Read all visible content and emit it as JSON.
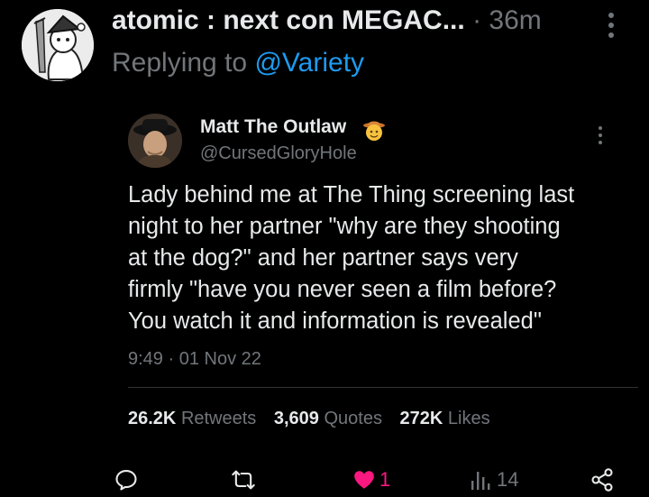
{
  "reply": {
    "display_name": "atomic : next con MEGAC...",
    "separator": "·",
    "time_ago": "36m",
    "replying_prefix": "Replying to",
    "replying_handle": "@Variety"
  },
  "quoted": {
    "display_name": "Matt The Outlaw",
    "handle": "@CursedGloryHole",
    "text": "Lady behind me at The Thing screening last\nnight to her partner \"why are they shooting\nat the dog?\"  and her partner says very\nfirmly \"have you never seen a film before?\nYou watch it and information is revealed\"",
    "timestamp": "9:49 · 01 Nov 22",
    "stats": [
      {
        "value": "26.2K",
        "label": "Retweets"
      },
      {
        "value": "3,609",
        "label": "Quotes"
      },
      {
        "value": "272K",
        "label": "Likes"
      }
    ]
  },
  "actions": {
    "like_count": "1",
    "view_count": "14"
  },
  "colors": {
    "background": "#000000",
    "text": "#e7e9ea",
    "muted": "#71767b",
    "link": "#1d9bf0",
    "like": "#f91880"
  },
  "icons": [
    "avatar-sketch",
    "avatar-photo",
    "cowboy-emoji",
    "more-icon",
    "reply-icon",
    "retweet-icon",
    "heart-icon",
    "views-icon",
    "share-icon"
  ]
}
